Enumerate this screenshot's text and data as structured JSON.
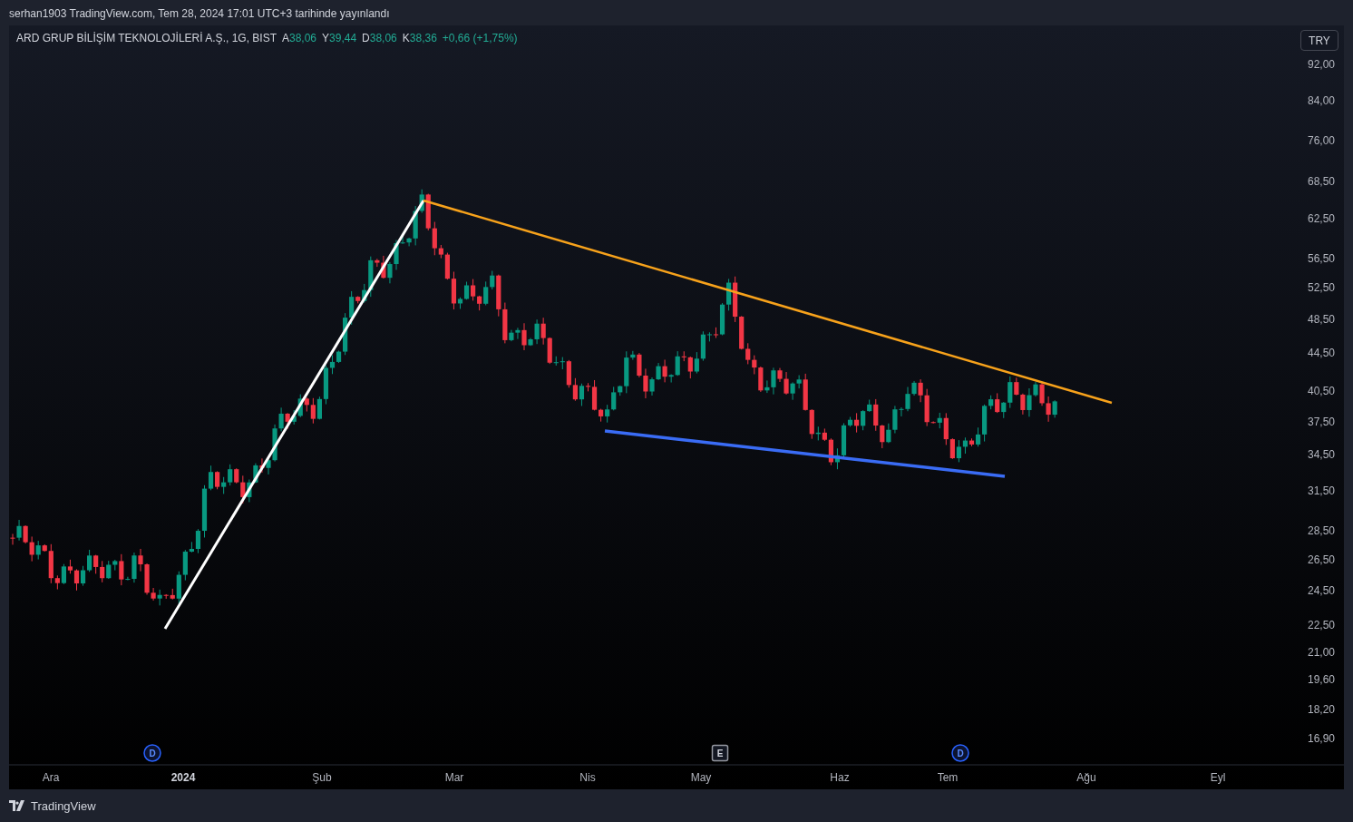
{
  "header": {
    "text": "serhan1903 TradingView.com, Tem 28, 2024 17:01 UTC+3 tarihinde yayınlandı"
  },
  "legend": {
    "symbol": "ARD GRUP BİLİŞİM TEKNOLOJİLERİ A.Ş., 1G, BIST",
    "ohlc": [
      {
        "label": "A",
        "value": "38,06"
      },
      {
        "label": "Y",
        "value": "39,44"
      },
      {
        "label": "D",
        "value": "38,06"
      },
      {
        "label": "K",
        "value": "38,36"
      }
    ],
    "change": "+0,66 (+1,75%)"
  },
  "currency_button": "TRY",
  "price_ticks": [
    "92,00",
    "84,00",
    "76,00",
    "68,50",
    "62,50",
    "56,50",
    "52,50",
    "48,50",
    "44,50",
    "40,50",
    "37,50",
    "34,50",
    "31,50",
    "28,50",
    "26,50",
    "24,50",
    "22,50",
    "21,00",
    "19,60",
    "18,20",
    "16,90"
  ],
  "time_labels": [
    {
      "text": "Ara",
      "kind": "month"
    },
    {
      "text": "2024",
      "kind": "year"
    },
    {
      "text": "Şub",
      "kind": "month"
    },
    {
      "text": "Mar",
      "kind": "month"
    },
    {
      "text": "Nis",
      "kind": "month"
    },
    {
      "text": "May",
      "kind": "month"
    },
    {
      "text": "Haz",
      "kind": "month"
    },
    {
      "text": "Tem",
      "kind": "month"
    },
    {
      "text": "Ağu",
      "kind": "month"
    },
    {
      "text": "Eyl",
      "kind": "month"
    }
  ],
  "events": [
    {
      "kind": "dividend",
      "label": "D"
    },
    {
      "kind": "earnings",
      "label": "E"
    },
    {
      "kind": "dividend",
      "label": "D"
    }
  ],
  "footer": {
    "brand": "TradingView"
  }
}
